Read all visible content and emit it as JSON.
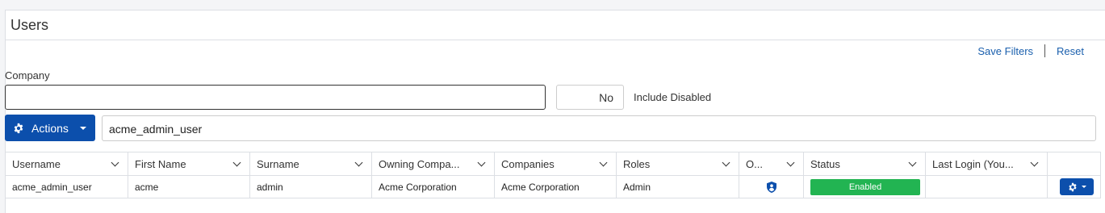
{
  "page": {
    "title": "Users"
  },
  "links": {
    "save_filters": "Save Filters",
    "reset": "Reset"
  },
  "filters": {
    "company_label": "Company",
    "company_value": "",
    "include_disabled_value": "No",
    "include_disabled_label": "Include Disabled"
  },
  "actions": {
    "label": "Actions",
    "icon": "gear-icon"
  },
  "search": {
    "value": "acme_admin_user"
  },
  "table": {
    "columns": [
      "Username",
      "First Name",
      "Surname",
      "Owning Compa...",
      "Companies",
      "Roles",
      "O...",
      "Status",
      "Last Login (You...",
      ""
    ],
    "rows": [
      {
        "username": "acme_admin_user",
        "first_name": "acme",
        "surname": "admin",
        "owning_company": "Acme Corporation",
        "companies": "Acme Corporation",
        "roles": "Admin",
        "owner_icon": "shield-user-icon",
        "status": "Enabled",
        "last_login": ""
      }
    ]
  },
  "colors": {
    "primary": "#0c4fac",
    "link": "#1a5fad",
    "status_enabled": "#22b452"
  }
}
